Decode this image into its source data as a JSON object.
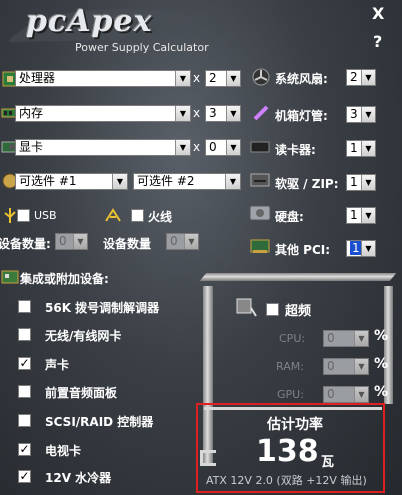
{
  "header": {
    "logo_text": "pcApex",
    "subtitle": "Power Supply Calculator",
    "close": "X",
    "help": "?"
  },
  "left_rows": {
    "cpu": {
      "value": "处理器",
      "mult": "x",
      "qty": "2"
    },
    "memory": {
      "value": "内存",
      "mult": "x",
      "qty": "3"
    },
    "gpu": {
      "value": "显卡",
      "mult": "x",
      "qty": "0"
    },
    "optional1": "可选件 #1",
    "optional2": "可选件 #2"
  },
  "usb": {
    "label": "USB",
    "count_label": "设备数量:",
    "count": "0"
  },
  "firewire": {
    "label": "火线",
    "count_label": "设备数量",
    "count": "0"
  },
  "right_rows": {
    "fans": {
      "label": "系统风扇:",
      "value": "2"
    },
    "lights": {
      "label": "机箱灯管:",
      "value": "3"
    },
    "cardreader": {
      "label": "读卡器:",
      "value": "1"
    },
    "floppy": {
      "label": "软驱 / ZIP:",
      "value": "1"
    },
    "harddisk": {
      "label": "硬盘:",
      "value": "1"
    },
    "pci": {
      "label": "其他 PCI:",
      "value": "1"
    }
  },
  "integrated": {
    "heading": "集成或附加设备:",
    "items": [
      {
        "label": "56K 拨号调制解调器",
        "checked": false
      },
      {
        "label": "无线/有线网卡",
        "checked": false
      },
      {
        "label": "声卡",
        "checked": true
      },
      {
        "label": "前置音频面板",
        "checked": false
      },
      {
        "label": "SCSI/RAID 控制器",
        "checked": false
      },
      {
        "label": "电视卡",
        "checked": true
      },
      {
        "label": "12V 水冷器",
        "checked": true
      }
    ]
  },
  "overclock": {
    "label": "超频",
    "checked": false,
    "cpu": {
      "label": "CPU:",
      "value": "0",
      "unit": "%"
    },
    "ram": {
      "label": "RAM:",
      "value": "0",
      "unit": "%"
    },
    "gpu": {
      "label": "GPU:",
      "value": "0",
      "unit": "%"
    }
  },
  "result": {
    "title": "估计功率",
    "value": "138",
    "unit": "瓦",
    "footer": "ATX 12V 2.0 (双路 +12V 输出)"
  },
  "colors": {
    "highlight_box": "#e02020",
    "pci_selected": "#1a4fd0"
  }
}
